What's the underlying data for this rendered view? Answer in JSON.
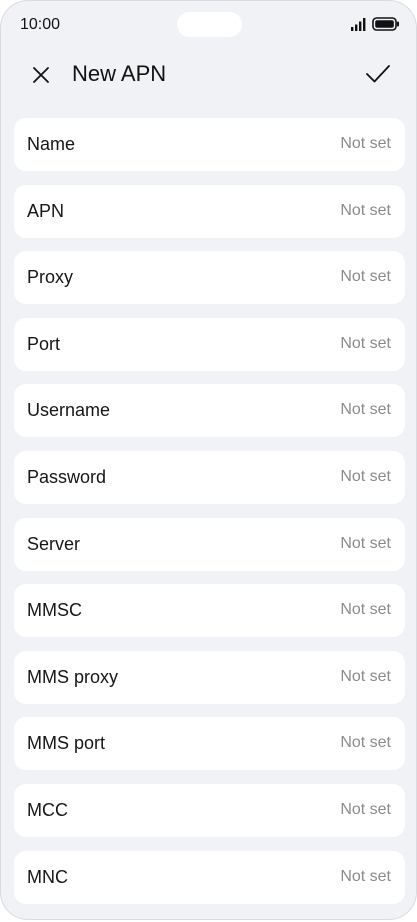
{
  "status_bar": {
    "time": "10:00",
    "icons": [
      "signal-icon",
      "battery-icon"
    ]
  },
  "header": {
    "title": "New APN",
    "close_icon": "close-icon",
    "confirm_icon": "check-icon"
  },
  "fields": [
    {
      "label": "Name",
      "value": "Not set"
    },
    {
      "label": "APN",
      "value": "Not set"
    },
    {
      "label": "Proxy",
      "value": "Not set"
    },
    {
      "label": "Port",
      "value": "Not set"
    },
    {
      "label": "Username",
      "value": "Not set"
    },
    {
      "label": "Password",
      "value": "Not set"
    },
    {
      "label": "Server",
      "value": "Not set"
    },
    {
      "label": "MMSC",
      "value": "Not set"
    },
    {
      "label": "MMS proxy",
      "value": "Not set"
    },
    {
      "label": "MMS port",
      "value": "Not set"
    },
    {
      "label": "MCC",
      "value": "Not set"
    },
    {
      "label": "MNC",
      "value": "Not set"
    }
  ],
  "colors": {
    "background": "#f1f2f6",
    "card": "#ffffff",
    "text": "#161616",
    "muted": "#8a8b8f"
  }
}
